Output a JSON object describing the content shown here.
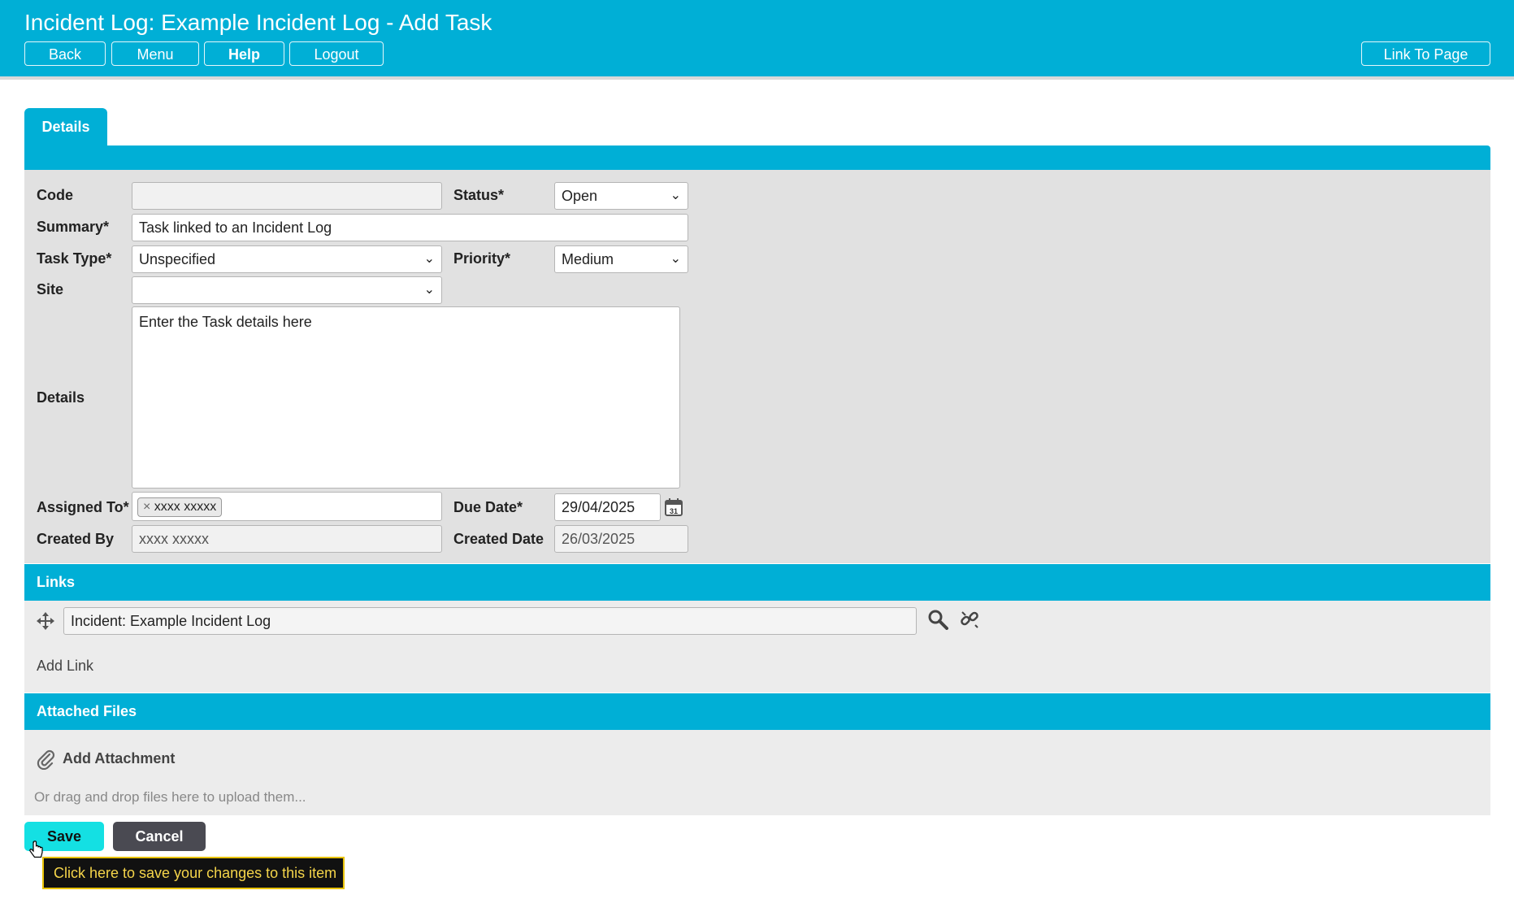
{
  "header": {
    "title": "Incident Log: Example Incident Log - Add Task",
    "buttons": {
      "back": "Back",
      "menu": "Menu",
      "help": "Help",
      "logout": "Logout",
      "link_to_page": "Link To Page"
    }
  },
  "tabs": [
    {
      "label": "Details"
    }
  ],
  "form": {
    "code": {
      "label": "Code",
      "value": ""
    },
    "status": {
      "label": "Status*",
      "value": "Open"
    },
    "summary": {
      "label": "Summary*",
      "value": "Task linked to an Incident Log"
    },
    "task_type": {
      "label": "Task Type*",
      "value": "Unspecified"
    },
    "priority": {
      "label": "Priority*",
      "value": "Medium"
    },
    "site": {
      "label": "Site",
      "value": ""
    },
    "details": {
      "label": "Details",
      "value": "Enter the Task details here"
    },
    "assigned_to": {
      "label": "Assigned To*",
      "tag": "xxxx xxxxx"
    },
    "due_date": {
      "label": "Due Date*",
      "value": "29/04/2025"
    },
    "created_by": {
      "label": "Created By",
      "value": "xxxx xxxxx"
    },
    "created_date": {
      "label": "Created Date",
      "value": "26/03/2025"
    }
  },
  "links": {
    "heading": "Links",
    "items": [
      {
        "value": "Incident: Example Incident Log"
      }
    ],
    "add_link": "Add Link"
  },
  "attachments": {
    "heading": "Attached Files",
    "add_attachment": "Add Attachment",
    "drop_hint": "Or drag and drop files here to upload them..."
  },
  "actions": {
    "save": "Save",
    "cancel": "Cancel"
  },
  "tooltip": "Click here to save your changes to this item",
  "colors": {
    "accent": "#00afd6",
    "save": "#14e0e3",
    "cancel": "#4a4a52",
    "tooltip_text": "#f5d54a"
  }
}
